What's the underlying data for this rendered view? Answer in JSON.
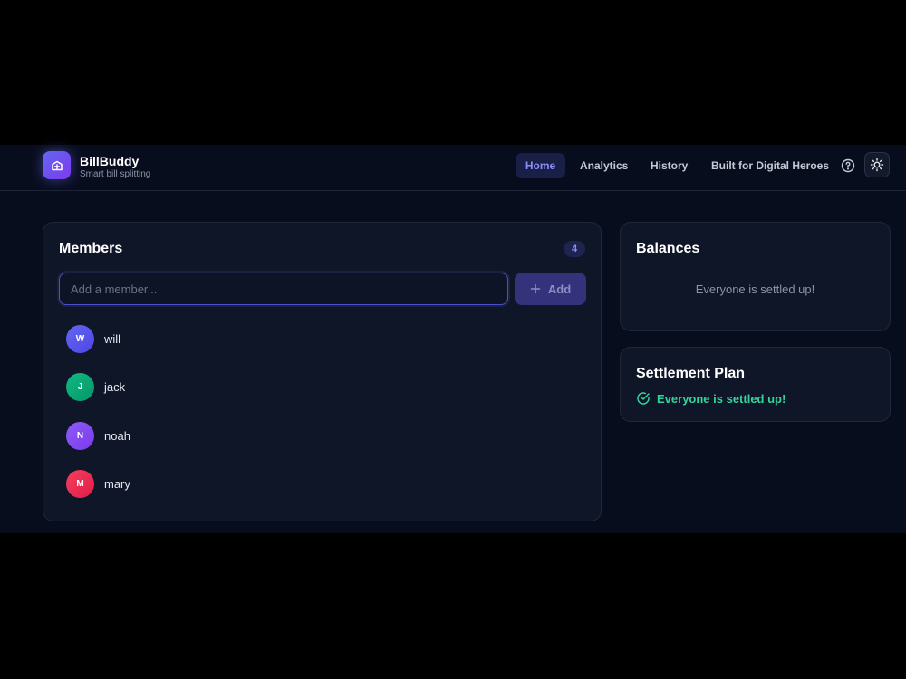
{
  "brand": {
    "title": "BillBuddy",
    "subtitle": "Smart bill splitting"
  },
  "nav": {
    "home": "Home",
    "analytics": "Analytics",
    "history": "History",
    "built": "Built for Digital Heroes"
  },
  "members": {
    "title": "Members",
    "count": "4",
    "input_placeholder": "Add a member...",
    "add_label": "Add",
    "items": [
      {
        "initial": "W",
        "name": "will",
        "color": "#5b5ff0"
      },
      {
        "initial": "J",
        "name": "jack",
        "color": "#10b981"
      },
      {
        "initial": "N",
        "name": "noah",
        "color": "#8b5cf6"
      },
      {
        "initial": "M",
        "name": "mary",
        "color": "#e11d48"
      }
    ]
  },
  "balances": {
    "title": "Balances",
    "empty": "Everyone is settled up!"
  },
  "settlement": {
    "title": "Settlement Plan",
    "status": "Everyone is settled up!"
  },
  "colors": {
    "accent": "#6366f1",
    "success": "#34d399",
    "background": "#080d1e",
    "card": "#0f1628"
  }
}
